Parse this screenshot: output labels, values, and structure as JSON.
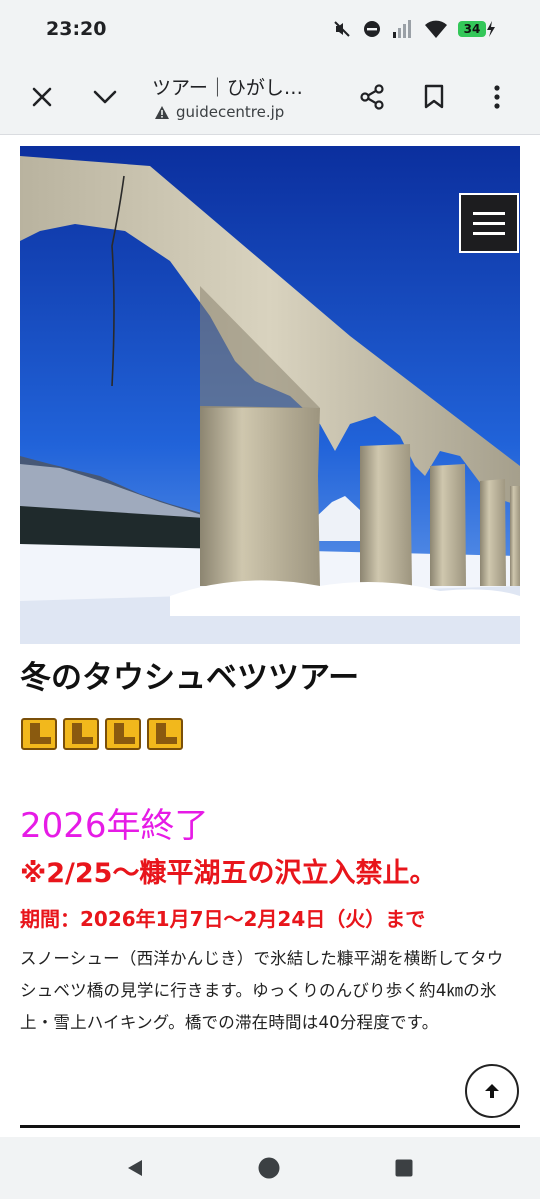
{
  "status_bar": {
    "time": "23:20",
    "icons": [
      "mute-icon",
      "do-not-disturb-icon",
      "signal-icon",
      "wifi-icon",
      "battery-charging-icon"
    ],
    "battery_level": "34"
  },
  "toolbar": {
    "title": "ツアー｜ひがし…",
    "url": "guidecentre.jp",
    "url_icon": "warning-icon"
  },
  "page": {
    "hero_alt_icon": "taushubetsu-bridge-image",
    "title": "冬のタウシュベツツアー",
    "boot_rating": 4,
    "ended_text": "2026年終了",
    "closure_text": "※2/25〜糠平湖五の沢立入禁止。",
    "period_text": "期間：2026年1月7日〜2月24日（火）まで",
    "description": "スノーシュー（西洋かんじき）で氷結した糠平湖を横断してタウシュベツ橋の見学に行きます。ゆっくりのんびり歩く約4㎞の氷上・雪上ハイキング。橋での滞在時間は40分程度です。"
  },
  "colors": {
    "ended": "#e61be6",
    "warning": "#e8151b",
    "sky": "#1b4fc7"
  }
}
